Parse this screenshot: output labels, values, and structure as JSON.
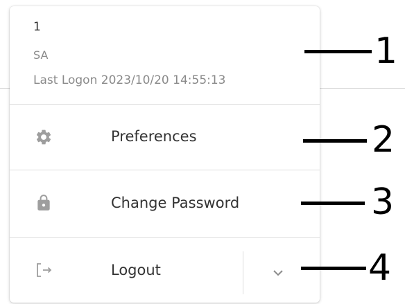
{
  "user": {
    "id": "1",
    "role": "SA",
    "last_logon": "Last Logon 2023/10/20 14:55:13"
  },
  "menu": {
    "preferences": {
      "label": "Preferences",
      "icon": "gear-icon"
    },
    "change_password": {
      "label": "Change Password",
      "icon": "lock-icon"
    },
    "logout": {
      "label": "Logout",
      "icon": "logout-icon"
    },
    "expand_icon": "chevron-down-icon"
  },
  "annotations": [
    "1",
    "2",
    "3",
    "4"
  ],
  "colors": {
    "text_primary": "#333333",
    "text_secondary": "#8a8a8a",
    "icon": "#9e9e9e",
    "divider": "#dcdcdc"
  }
}
